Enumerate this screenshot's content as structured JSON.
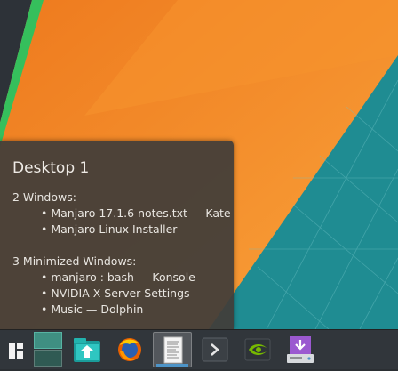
{
  "wallpaper": {
    "colors": {
      "dark": "#2d3238",
      "green": "#35bf5c",
      "teal": "#1f8c92",
      "orange": "#f37f20",
      "orange_light": "#f8a53b",
      "orange_dark": "#e56a1c"
    }
  },
  "tooltip": {
    "title": "Desktop 1",
    "windows_header": "2 Windows:",
    "windows": [
      "• Manjaro 17.1.6 notes.txt — Kate",
      "• Manjaro Linux Installer"
    ],
    "minimized_header": "3 Minimized Windows:",
    "minimized": [
      "• manjaro : bash — Konsole",
      "• NVIDIA X Server Settings",
      "• Music — Dolphin"
    ]
  },
  "taskbar": {
    "background": "#31363b",
    "accent": "#4d94c8",
    "icons": [
      "app-launcher-icon",
      "pager-icon",
      "dolphin-icon",
      "firefox-icon",
      "kate-icon",
      "konsole-icon",
      "nvidia-icon",
      "installer-icon"
    ]
  }
}
